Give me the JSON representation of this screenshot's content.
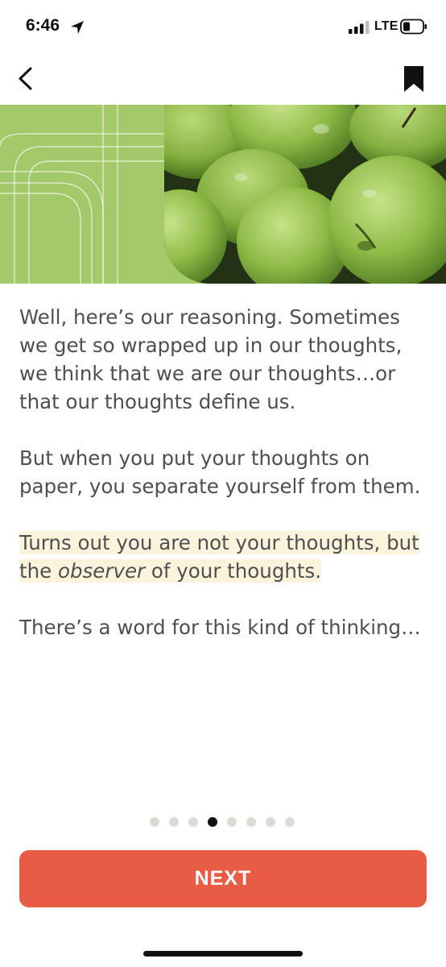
{
  "status_bar": {
    "time": "6:46",
    "network": "LTE",
    "icons": [
      "location-arrow-icon",
      "signal-bars-icon",
      "battery-icon"
    ]
  },
  "nav": {
    "back_icon": "chevron-left-icon",
    "bookmark_icon": "bookmark-icon"
  },
  "hero": {
    "image": "green-apples-photo",
    "accent_color": "#a4c96a"
  },
  "content": {
    "paragraph1": "Well, here’s our reasoning. Sometimes we get so wrapped up in our thoughts, we think that we are our thoughts…or that our thoughts define us.",
    "paragraph2": "But when you put your thoughts on paper, you separate yourself from them.",
    "paragraph3_part1": "Turns out you are not your thoughts, but the ",
    "paragraph3_emphasis": "observer",
    "paragraph3_part2": " of your thoughts.",
    "paragraph4": "There’s a word for this kind of thinking…"
  },
  "pager": {
    "total": 8,
    "current": 4
  },
  "next_button": {
    "label": "NEXT",
    "color": "#e85c45"
  }
}
